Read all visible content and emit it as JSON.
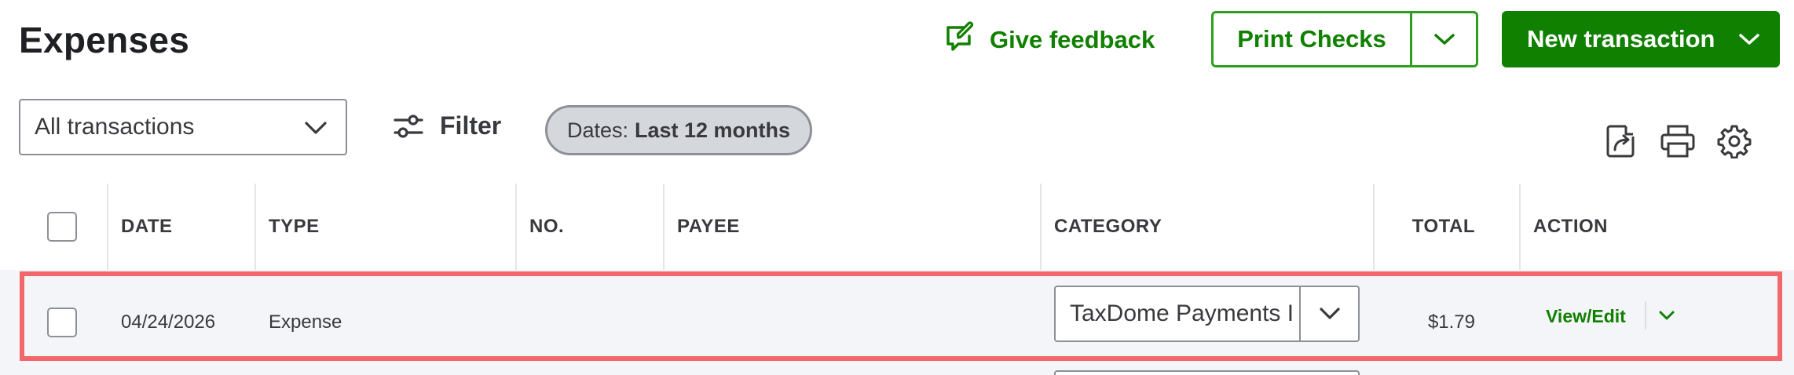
{
  "header": {
    "title": "Expenses",
    "feedback_label": "Give feedback",
    "print_checks_label": "Print Checks",
    "new_transaction_label": "New transaction"
  },
  "toolbar": {
    "transactions_select": "All transactions",
    "filter_label": "Filter",
    "dates_prefix": "Dates:",
    "dates_value": "Last 12 months",
    "icons": [
      "export-icon",
      "print-icon",
      "settings-gear-icon"
    ]
  },
  "table": {
    "columns": [
      "DATE",
      "TYPE",
      "NO.",
      "PAYEE",
      "CATEGORY",
      "TOTAL",
      "ACTION"
    ],
    "rows": [
      {
        "date": "04/24/2026",
        "type": "Expense",
        "no": "",
        "payee": "",
        "category": "TaxDome Payments I",
        "total": "$1.79",
        "action": "View/Edit"
      }
    ]
  },
  "colors": {
    "brand_green": "#108000",
    "border_green": "#2ca01c",
    "highlight_red": "#f2676a",
    "row_bg": "#f4f5f8"
  }
}
